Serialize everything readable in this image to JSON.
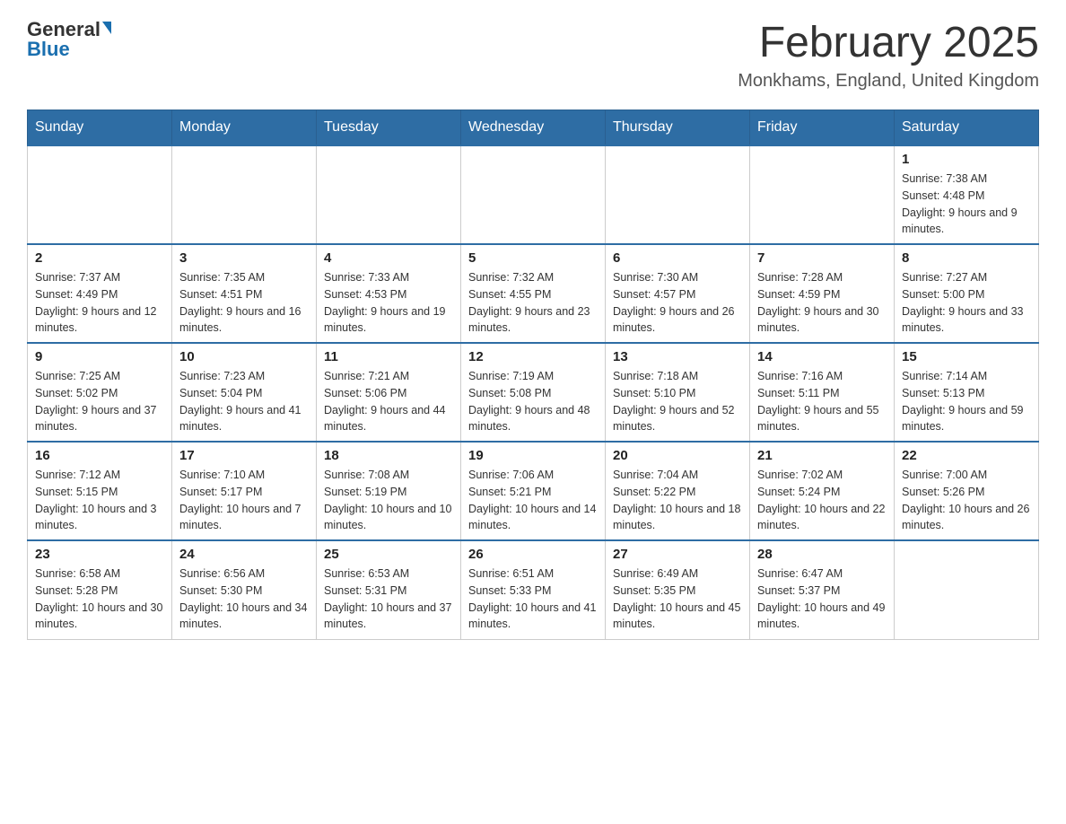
{
  "header": {
    "logo_general": "General",
    "logo_blue": "Blue",
    "month_title": "February 2025",
    "location": "Monkhams, England, United Kingdom"
  },
  "weekdays": [
    "Sunday",
    "Monday",
    "Tuesday",
    "Wednesday",
    "Thursday",
    "Friday",
    "Saturday"
  ],
  "weeks": [
    [
      {
        "day": "",
        "info": ""
      },
      {
        "day": "",
        "info": ""
      },
      {
        "day": "",
        "info": ""
      },
      {
        "day": "",
        "info": ""
      },
      {
        "day": "",
        "info": ""
      },
      {
        "day": "",
        "info": ""
      },
      {
        "day": "1",
        "info": "Sunrise: 7:38 AM\nSunset: 4:48 PM\nDaylight: 9 hours and 9 minutes."
      }
    ],
    [
      {
        "day": "2",
        "info": "Sunrise: 7:37 AM\nSunset: 4:49 PM\nDaylight: 9 hours and 12 minutes."
      },
      {
        "day": "3",
        "info": "Sunrise: 7:35 AM\nSunset: 4:51 PM\nDaylight: 9 hours and 16 minutes."
      },
      {
        "day": "4",
        "info": "Sunrise: 7:33 AM\nSunset: 4:53 PM\nDaylight: 9 hours and 19 minutes."
      },
      {
        "day": "5",
        "info": "Sunrise: 7:32 AM\nSunset: 4:55 PM\nDaylight: 9 hours and 23 minutes."
      },
      {
        "day": "6",
        "info": "Sunrise: 7:30 AM\nSunset: 4:57 PM\nDaylight: 9 hours and 26 minutes."
      },
      {
        "day": "7",
        "info": "Sunrise: 7:28 AM\nSunset: 4:59 PM\nDaylight: 9 hours and 30 minutes."
      },
      {
        "day": "8",
        "info": "Sunrise: 7:27 AM\nSunset: 5:00 PM\nDaylight: 9 hours and 33 minutes."
      }
    ],
    [
      {
        "day": "9",
        "info": "Sunrise: 7:25 AM\nSunset: 5:02 PM\nDaylight: 9 hours and 37 minutes."
      },
      {
        "day": "10",
        "info": "Sunrise: 7:23 AM\nSunset: 5:04 PM\nDaylight: 9 hours and 41 minutes."
      },
      {
        "day": "11",
        "info": "Sunrise: 7:21 AM\nSunset: 5:06 PM\nDaylight: 9 hours and 44 minutes."
      },
      {
        "day": "12",
        "info": "Sunrise: 7:19 AM\nSunset: 5:08 PM\nDaylight: 9 hours and 48 minutes."
      },
      {
        "day": "13",
        "info": "Sunrise: 7:18 AM\nSunset: 5:10 PM\nDaylight: 9 hours and 52 minutes."
      },
      {
        "day": "14",
        "info": "Sunrise: 7:16 AM\nSunset: 5:11 PM\nDaylight: 9 hours and 55 minutes."
      },
      {
        "day": "15",
        "info": "Sunrise: 7:14 AM\nSunset: 5:13 PM\nDaylight: 9 hours and 59 minutes."
      }
    ],
    [
      {
        "day": "16",
        "info": "Sunrise: 7:12 AM\nSunset: 5:15 PM\nDaylight: 10 hours and 3 minutes."
      },
      {
        "day": "17",
        "info": "Sunrise: 7:10 AM\nSunset: 5:17 PM\nDaylight: 10 hours and 7 minutes."
      },
      {
        "day": "18",
        "info": "Sunrise: 7:08 AM\nSunset: 5:19 PM\nDaylight: 10 hours and 10 minutes."
      },
      {
        "day": "19",
        "info": "Sunrise: 7:06 AM\nSunset: 5:21 PM\nDaylight: 10 hours and 14 minutes."
      },
      {
        "day": "20",
        "info": "Sunrise: 7:04 AM\nSunset: 5:22 PM\nDaylight: 10 hours and 18 minutes."
      },
      {
        "day": "21",
        "info": "Sunrise: 7:02 AM\nSunset: 5:24 PM\nDaylight: 10 hours and 22 minutes."
      },
      {
        "day": "22",
        "info": "Sunrise: 7:00 AM\nSunset: 5:26 PM\nDaylight: 10 hours and 26 minutes."
      }
    ],
    [
      {
        "day": "23",
        "info": "Sunrise: 6:58 AM\nSunset: 5:28 PM\nDaylight: 10 hours and 30 minutes."
      },
      {
        "day": "24",
        "info": "Sunrise: 6:56 AM\nSunset: 5:30 PM\nDaylight: 10 hours and 34 minutes."
      },
      {
        "day": "25",
        "info": "Sunrise: 6:53 AM\nSunset: 5:31 PM\nDaylight: 10 hours and 37 minutes."
      },
      {
        "day": "26",
        "info": "Sunrise: 6:51 AM\nSunset: 5:33 PM\nDaylight: 10 hours and 41 minutes."
      },
      {
        "day": "27",
        "info": "Sunrise: 6:49 AM\nSunset: 5:35 PM\nDaylight: 10 hours and 45 minutes."
      },
      {
        "day": "28",
        "info": "Sunrise: 6:47 AM\nSunset: 5:37 PM\nDaylight: 10 hours and 49 minutes."
      },
      {
        "day": "",
        "info": ""
      }
    ]
  ]
}
